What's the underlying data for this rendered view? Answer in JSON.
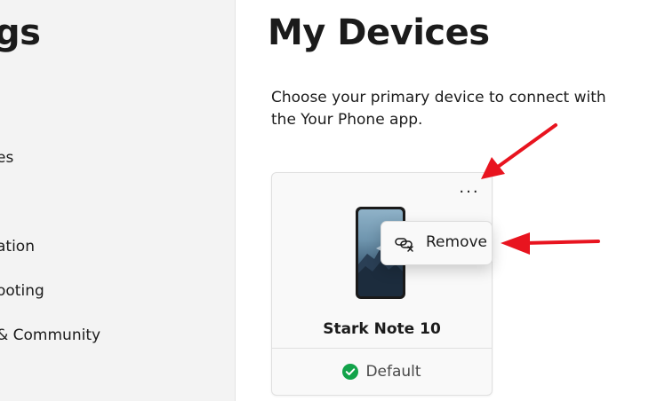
{
  "sidebar": {
    "title": "gs",
    "items": [
      {
        "label": "es"
      },
      {
        "label": "ation"
      },
      {
        "label": "ooting"
      },
      {
        "label": "& Community"
      }
    ]
  },
  "main": {
    "title": "My Devices",
    "description": "Choose your primary device to connect with the Your Phone app.",
    "device_card": {
      "more_label": "···",
      "device_name": "Stark Note 10",
      "status_label": "Default"
    },
    "context_menu": {
      "items": [
        {
          "label": "Remove",
          "icon": "unlink-icon"
        }
      ]
    }
  },
  "colors": {
    "accent_green": "#12a34a",
    "annotation_red": "#e8141f"
  }
}
